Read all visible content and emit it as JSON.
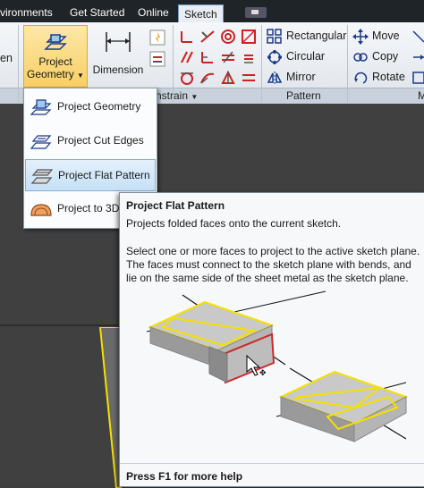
{
  "tabs": {
    "environments": "vironments",
    "get_started": "Get Started",
    "online": "Online",
    "sketch": "Sketch"
  },
  "ribbon": {
    "partial_left_label": "en",
    "project_geometry": {
      "line1": "Project",
      "line2": "Geometry"
    },
    "dimension": "Dimension",
    "pattern_tools": {
      "rectangular": "Rectangular",
      "circular": "Circular",
      "mirror": "Mirror"
    },
    "modify_tools": {
      "move": "Move",
      "copy": "Copy",
      "rotate": "Rotate"
    },
    "panels": {
      "constrain": "nstrain",
      "pattern": "Pattern",
      "modify": "M"
    }
  },
  "dropdown": {
    "items": [
      "Project Geometry",
      "Project Cut Edges",
      "Project Flat Pattern",
      "Project to 3D"
    ]
  },
  "tooltip": {
    "title": "Project Flat Pattern",
    "description": "Projects folded faces onto the current sketch.",
    "body": "Select one or more faces to project to the active sketch plane. The faces must connect to the sketch plane with bends, and lie on the same side of the sheet metal as the sketch plane.",
    "footer": "Press F1 for more help"
  },
  "colors": {
    "accent_highlight": "#f7cf63",
    "selection_yellow": "#f5e000",
    "selected_face_red": "#cc2a2a",
    "ribbon_bg": "#e8ecf1",
    "viewport_bg": "#404040"
  },
  "icons": {
    "project_geometry": "project-geometry-icon",
    "dimension": "dimension-icon",
    "rectangular": "rectangular-pattern-icon",
    "circular": "circular-pattern-icon",
    "mirror": "mirror-icon",
    "move": "move-icon",
    "copy": "copy-icon",
    "rotate": "rotate-icon"
  }
}
